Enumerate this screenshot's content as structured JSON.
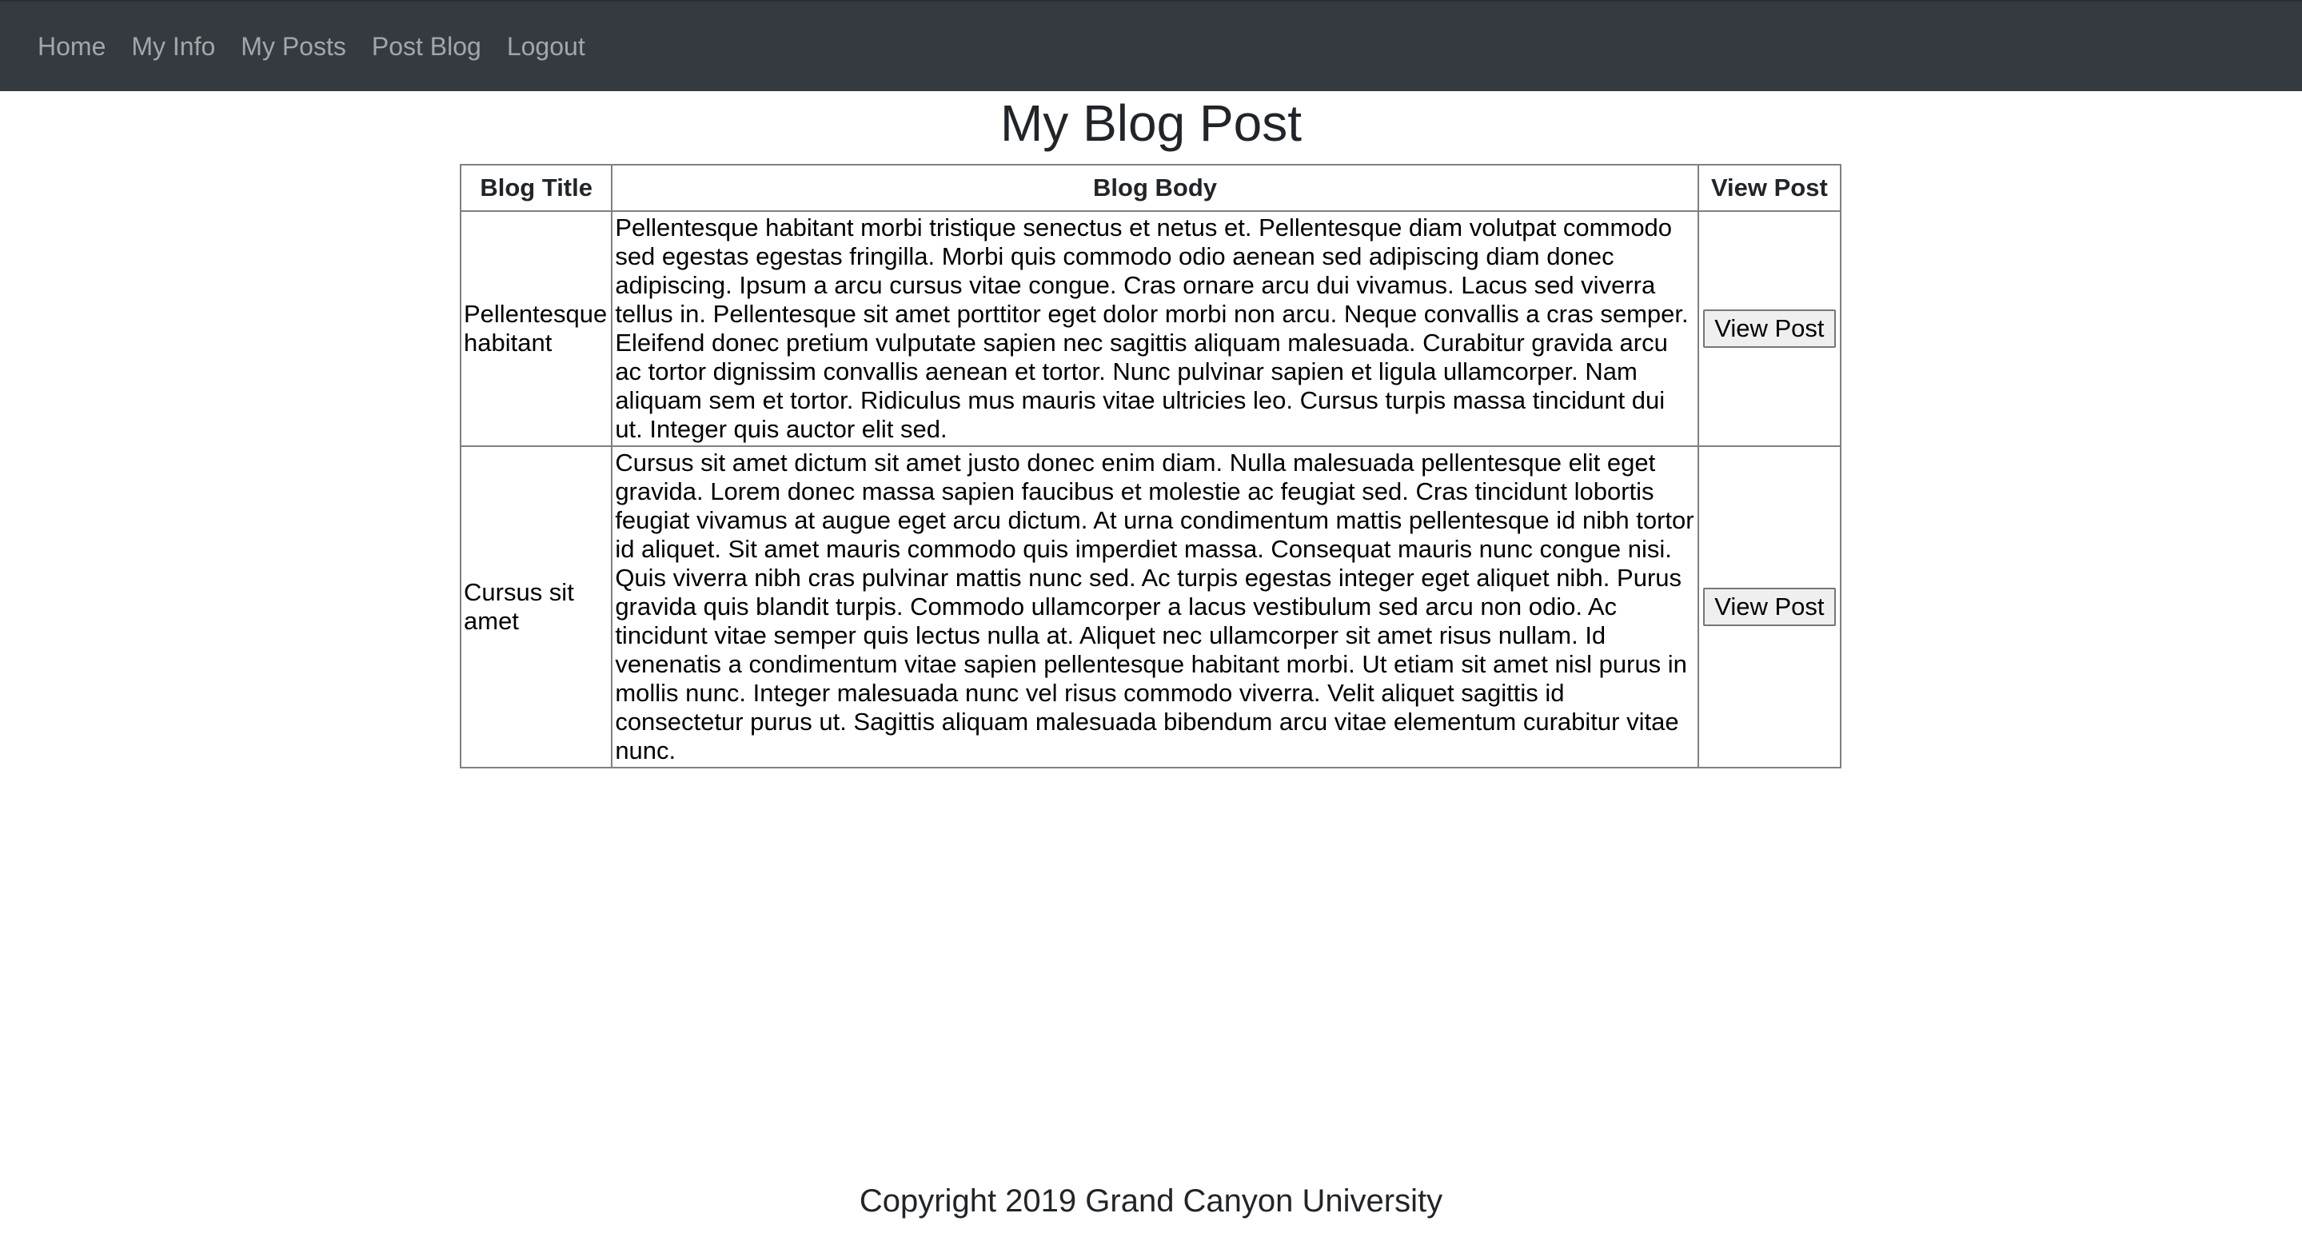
{
  "nav": {
    "items": [
      {
        "label": "Home"
      },
      {
        "label": "My Info"
      },
      {
        "label": "My Posts"
      },
      {
        "label": "Post Blog"
      },
      {
        "label": "Logout"
      }
    ]
  },
  "page": {
    "title": "My Blog Post"
  },
  "table": {
    "headers": {
      "title": "Blog Title",
      "body": "Blog Body",
      "view": "View Post"
    },
    "rows": [
      {
        "title": "Pellentesque habitant",
        "body": "Pellentesque habitant morbi tristique senectus et netus et. Pellentesque diam volutpat commodo sed egestas egestas fringilla. Morbi quis commodo odio aenean sed adipiscing diam donec adipiscing. Ipsum a arcu cursus vitae congue. Cras ornare arcu dui vivamus. Lacus sed viverra tellus in. Pellentesque sit amet porttitor eget dolor morbi non arcu. Neque convallis a cras semper. Eleifend donec pretium vulputate sapien nec sagittis aliquam malesuada. Curabitur gravida arcu ac tortor dignissim convallis aenean et tortor. Nunc pulvinar sapien et ligula ullamcorper. Nam aliquam sem et tortor. Ridiculus mus mauris vitae ultricies leo. Cursus turpis massa tincidunt dui ut. Integer quis auctor elit sed.",
        "button": "View Post"
      },
      {
        "title": "Cursus sit amet",
        "body": "Cursus sit amet dictum sit amet justo donec enim diam. Nulla malesuada pellentesque elit eget gravida. Lorem donec massa sapien faucibus et molestie ac feugiat sed. Cras tincidunt lobortis feugiat vivamus at augue eget arcu dictum. At urna condimentum mattis pellentesque id nibh tortor id aliquet. Sit amet mauris commodo quis imperdiet massa. Consequat mauris nunc congue nisi. Quis viverra nibh cras pulvinar mattis nunc sed. Ac turpis egestas integer eget aliquet nibh. Purus gravida quis blandit turpis. Commodo ullamcorper a lacus vestibulum sed arcu non odio. Ac tincidunt vitae semper quis lectus nulla at. Aliquet nec ullamcorper sit amet risus nullam. Id venenatis a condimentum vitae sapien pellentesque habitant morbi. Ut etiam sit amet nisl purus in mollis nunc. Integer malesuada nunc vel risus commodo viverra. Velit aliquet sagittis id consectetur purus ut. Sagittis aliquam malesuada bibendum arcu vitae elementum curabitur vitae nunc.",
        "button": "View Post"
      }
    ]
  },
  "footer": {
    "text": "Copyright 2019 Grand Canyon University"
  }
}
